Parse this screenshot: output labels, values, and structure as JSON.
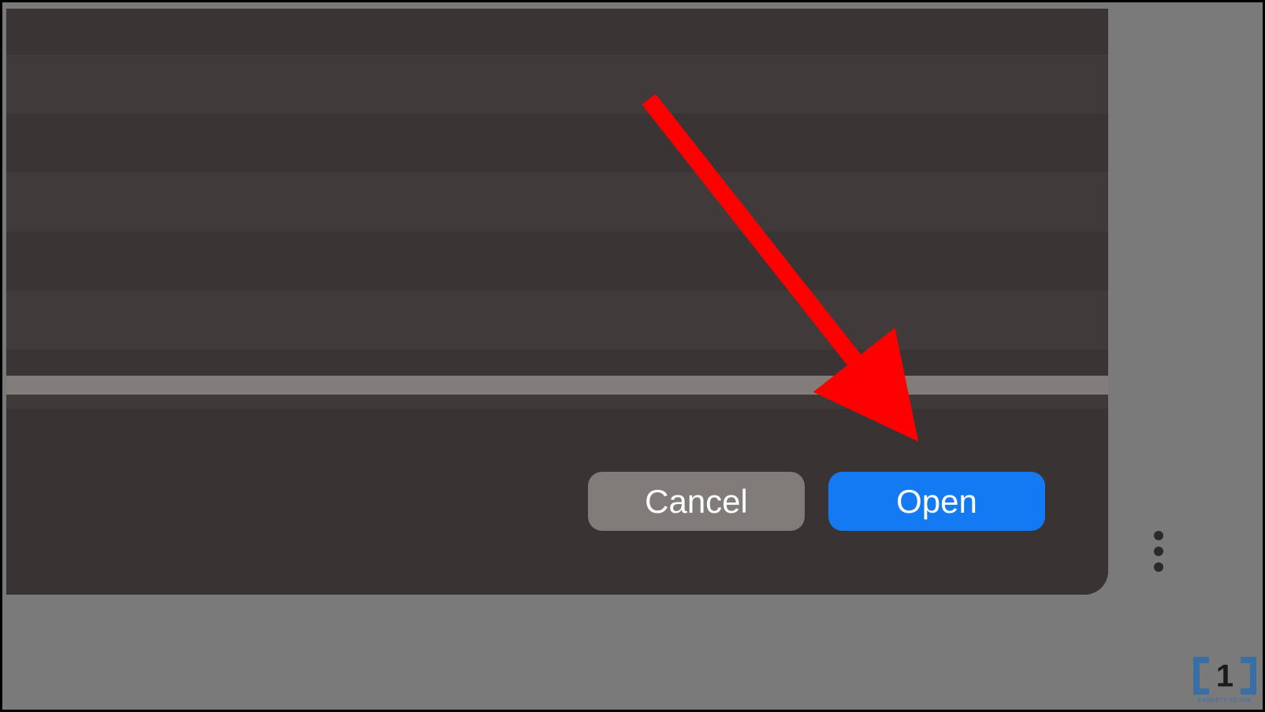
{
  "dialog": {
    "cancel_label": "Cancel",
    "open_label": "Open"
  },
  "watermark": {
    "text": "GADGETS TO USE"
  },
  "annotation": {
    "arrow_color": "#ff0000"
  }
}
